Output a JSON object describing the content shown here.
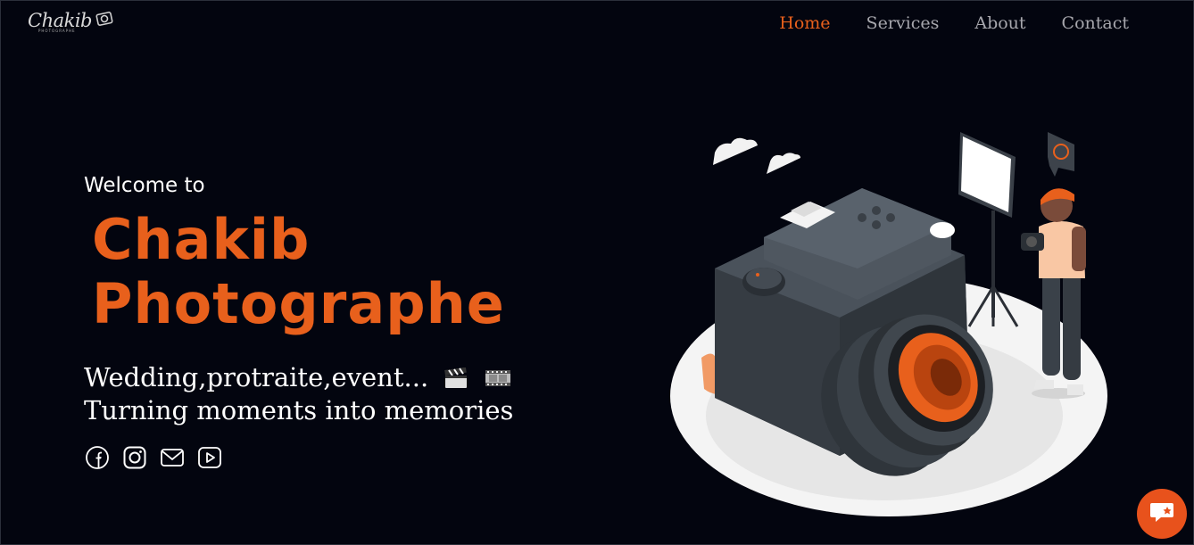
{
  "header": {
    "logo_text": "Chakib",
    "logo_subtext": "PHOTOGRAPHE",
    "nav": [
      {
        "label": "Home",
        "active": true
      },
      {
        "label": "Services",
        "active": false
      },
      {
        "label": "About",
        "active": false
      },
      {
        "label": "Contact",
        "active": false
      }
    ]
  },
  "hero": {
    "welcome": "Welcome to",
    "title_line1": "Chakib",
    "title_line2": "Photographe",
    "tagline_line1": "Wedding,protraite,event...",
    "tagline_line2": "Turning moments into memories",
    "tagline_icons": [
      "clapper-board-icon",
      "film-strip-icon"
    ],
    "socials": [
      "facebook-icon",
      "instagram-icon",
      "mail-icon",
      "youtube-icon"
    ]
  },
  "colors": {
    "accent": "#e8601c",
    "background": "#03050f",
    "nav_text": "#a7a7ad",
    "text": "#ffffff"
  },
  "chat_button": {
    "icon": "chat-bubble-icon"
  }
}
